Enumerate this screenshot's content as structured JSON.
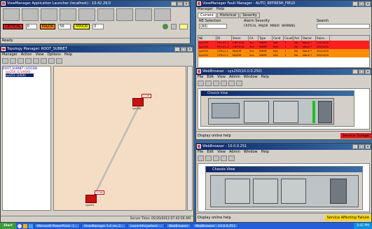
{
  "launcher": {
    "title": "ViewManager Application Launcher (localhost) - 10.42.29.0",
    "critical_label": "CRITICAL",
    "critical_count": "0",
    "major_label": "MAJOR",
    "major_count": "56",
    "minor_label": "MINOR",
    "minor_count": "0",
    "status": "Ready",
    "icons": [
      "inventory-icon",
      "map-icon",
      "alarm-icon",
      "history-icon",
      "report-icon",
      "building-icon",
      "truck-icon",
      "device-icon",
      "settings-icon"
    ]
  },
  "topology": {
    "title": "Topology Manager: ROOT_SUBNET",
    "menu": [
      "Manager",
      "Action",
      "View",
      "Options",
      "Help"
    ],
    "tree": [
      "ROOT_SUBNET (3/0/108)",
      "sys250 (1/1/06/6)",
      "sys251 (2/0/0)"
    ],
    "node_a": {
      "badge": "1 Crit",
      "label": "sys250"
    },
    "node_b": {
      "badge": "1 Crit",
      "label": "sys251"
    },
    "server_time": "Server Time: 05/20/2012 07:42:56 AM"
  },
  "fault": {
    "title": "ViewManager Fault Manager - AUTO_REFRESH_FIELD",
    "menu": [
      "Manager",
      "Help"
    ],
    "tabs": [
      "Current",
      "Historical",
      "Severity"
    ],
    "ne_selection_label": "NE Selection",
    "ne_selection_value": "(All)",
    "severity_label": "Alarm Severity",
    "severities": [
      "CRITICAL",
      "MAJOR",
      "MINOR",
      "WARNING"
    ],
    "search_label": "Search",
    "columns": [
      "NE",
      "ID",
      "Sever.",
      "CA",
      "Type",
      "Cond",
      "Count",
      "Ack",
      "Owner",
      "Raise..."
    ],
    "rows": [
      [
        "sys250",
        "FEL-01-1",
        "CRITICAL",
        "Svc",
        "SNMP",
        "N/A",
        "1",
        "No",
        "None *",
        "05/24/20"
      ],
      [
        "sys250",
        "FEL-01-2",
        "CRITICAL",
        "Svc",
        "SNMP",
        "N/A",
        "1",
        "No",
        "None *",
        "05/24/20"
      ],
      [
        "sys251",
        "CTRL1-1",
        "MAJOR",
        "Svc",
        "SNMP",
        "N/A",
        "1",
        "No",
        "None *",
        "05/24/20"
      ],
      [
        "sys251",
        "CTRL1-1",
        "MAJOR",
        "Svc",
        "SNMP",
        "N/A",
        "1",
        "No",
        "None *",
        "05/24/20"
      ]
    ],
    "row_colors": [
      "#ff2020",
      "#ff2020",
      "#ff8c00",
      "#ff8c00"
    ]
  },
  "webbrowser1": {
    "title": "WebBrowser - sys250(10.0.0.250)",
    "menu": [
      "File",
      "Edit",
      "View",
      "Admin",
      "Window",
      "Help"
    ],
    "chassis_title": "Chassis View",
    "status_text": "Display online help",
    "badge": "Service Outage",
    "badge_color": "#e02020"
  },
  "webbrowser2": {
    "title": "WebBrowser - 10.0.0.251",
    "menu": [
      "File",
      "Edit",
      "View",
      "Admin",
      "Window",
      "Help"
    ],
    "chassis_title": "Chassis View",
    "status_text": "Display online help",
    "badge": "Service Affecting Failure",
    "badge_color": "#ffd700"
  },
  "taskbar": {
    "start": "Start",
    "items": [
      "Microsoft PowerPoint - [...",
      "ViewManager 1.4 rev 2...",
      "LaunchAnywhere ...",
      "WebBrowser",
      "WebBrowser - 10.0.0.251"
    ],
    "clock": "3:42 PM"
  }
}
